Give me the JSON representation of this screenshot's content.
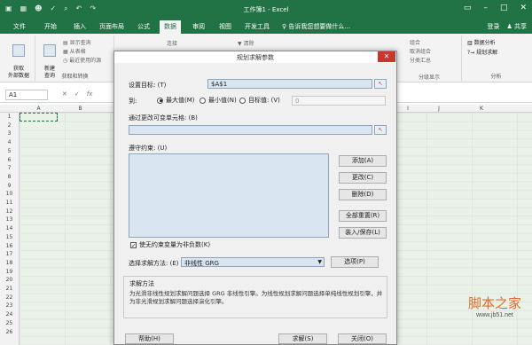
{
  "window": {
    "title": "工作簿1 - Excel",
    "qat_icons": [
      "save-icon",
      "table-icon",
      "user-icon",
      "check-icon",
      "search-icon",
      "undo-icon",
      "redo-icon"
    ]
  },
  "ribbon": {
    "file_label": "文件",
    "tabs": [
      "开始",
      "插入",
      "页面布局",
      "公式",
      "数据",
      "审阅",
      "视图",
      "开发工具"
    ],
    "active_tab": "数据",
    "tellme": "告诉我您想要做什么...",
    "login": "登录",
    "share": "共享",
    "get_external": "获取\n外部数据",
    "new_query": "新建\n查询",
    "show_queries": "显示查询",
    "from_table": "从表格",
    "recent_sources": "最近使用的源",
    "group_get_transform": "获取和转换",
    "connections": "连接",
    "clear": "清除",
    "group_outline": "分级显示",
    "group_analysis": "分析",
    "data_analysis": "数据分析",
    "solver": "规划求解",
    "combine": "组合",
    "cancel_combine": "取消组合",
    "subtotal": "分类汇总"
  },
  "formula_bar": {
    "name_box": "A1",
    "icons": [
      "cancel-icon",
      "enter-icon",
      "fx-icon"
    ]
  },
  "grid": {
    "columns": [
      "A",
      "B",
      "C",
      "D",
      "E",
      "F",
      "G",
      "H",
      "I",
      "J",
      "K"
    ],
    "rows": [
      "1",
      "2",
      "3",
      "4",
      "5",
      "6",
      "7",
      "8",
      "9",
      "10",
      "11",
      "12",
      "13",
      "14",
      "15",
      "16",
      "17",
      "18",
      "19",
      "20",
      "21",
      "22",
      "23",
      "24",
      "25",
      "26"
    ]
  },
  "dialog": {
    "title": "规划求解参数",
    "set_objective_label": "设置目标: (T)",
    "set_objective_value": "$A$1",
    "to_label": "到:",
    "opt_max": "最大值(M)",
    "opt_min": "最小值(N)",
    "opt_value": "目标值: (V)",
    "value_field": "0",
    "selected_option": "max",
    "changing_cells_label": "通过更改可变单元格: (B)",
    "changing_cells_value": "",
    "constraints_label": "遵守约束: (U)",
    "btn_add": "添加(A)",
    "btn_change": "更改(C)",
    "btn_delete": "删除(D)",
    "btn_reset_all": "全部重置(R)",
    "btn_load_save": "装入/保存(L)",
    "nonneg_label": "使无约束变量为非负数(K)",
    "nonneg_checked": true,
    "method_label": "选择求解方法: (E)",
    "method_value": "非线性 GRG",
    "btn_options": "选项(P)",
    "method_section_title": "求解方法",
    "method_description": "为光滑非线性规划求解问题选择 GRG 非线性引擎。为线性规划求解问题选择单纯线性规划引擎，并为非光滑规划求解问题选择演化引擎。",
    "btn_help": "帮助(H)",
    "btn_solve": "求解(S)",
    "btn_close": "关闭(O)"
  },
  "watermark": {
    "text": "脚本之家",
    "url": "www.jb51.net"
  },
  "colors": {
    "excel_green": "#217346",
    "close_red": "#c8372d",
    "field_blue": "#d9e6f2",
    "watermark_orange": "#e26a2c"
  }
}
